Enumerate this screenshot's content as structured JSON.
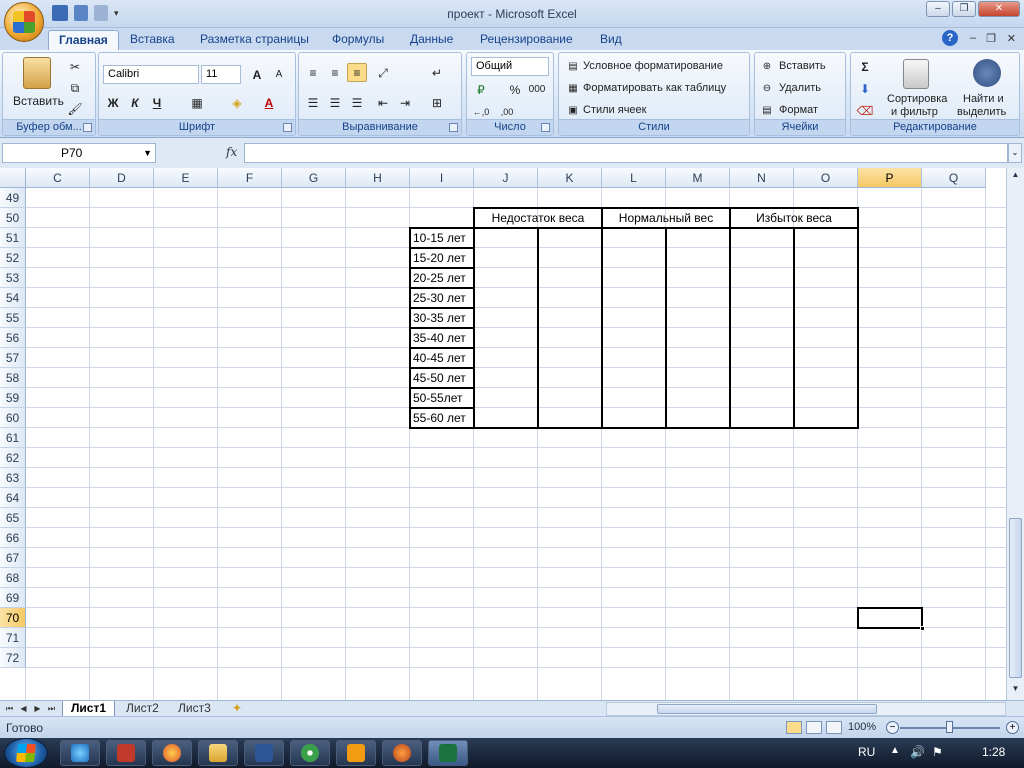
{
  "window": {
    "title": "проект - Microsoft Excel"
  },
  "ribbon_tabs": [
    "Главная",
    "Вставка",
    "Разметка страницы",
    "Формулы",
    "Данные",
    "Рецензирование",
    "Вид"
  ],
  "ribbon": {
    "clipboard": {
      "paste": "Вставить",
      "label": "Буфер обм..."
    },
    "font": {
      "name": "Calibri",
      "size": "11",
      "bold": "Ж",
      "italic": "К",
      "underline": "Ч",
      "label": "Шрифт"
    },
    "alignment": {
      "label": "Выравнивание"
    },
    "number": {
      "format": "Общий",
      "percent": "%",
      "thousands": "000",
      "label": "Число"
    },
    "styles": {
      "conditional": "Условное форматирование",
      "format_table": "Форматировать как таблицу",
      "cell_styles": "Стили ячеек",
      "label": "Стили"
    },
    "cells": {
      "insert": "Вставить",
      "delete": "Удалить",
      "format": "Формат",
      "label": "Ячейки"
    },
    "editing": {
      "sum": "Σ",
      "sort_line1": "Сортировка",
      "sort_line2": "и фильтр",
      "find_line1": "Найти и",
      "find_line2": "выделить",
      "label": "Редактирование"
    }
  },
  "formula_bar": {
    "name_box": "P70",
    "fx": "fx",
    "formula": ""
  },
  "columns": [
    "C",
    "D",
    "E",
    "F",
    "G",
    "H",
    "I",
    "J",
    "K",
    "L",
    "M",
    "N",
    "O",
    "P",
    "Q"
  ],
  "rows": [
    "49",
    "50",
    "51",
    "52",
    "53",
    "54",
    "55",
    "56",
    "57",
    "58",
    "59",
    "60",
    "61",
    "62",
    "63",
    "64",
    "65",
    "66",
    "67",
    "68",
    "69",
    "70",
    "71",
    "72"
  ],
  "selected": {
    "column": "P",
    "row": "70"
  },
  "table": {
    "headers": [
      "Недостаток веса",
      "Нормальный вес",
      "Избыток веса"
    ],
    "age_groups": [
      "10-15 лет",
      "15-20 лет",
      "20-25 лет",
      "25-30 лет",
      "30-35 лет",
      "35-40 лет",
      "40-45 лет",
      "45-50 лет",
      "50-55лет",
      "55-60 лет"
    ]
  },
  "sheet_tabs": [
    "Лист1",
    "Лист2",
    "Лист3"
  ],
  "active_sheet": "Лист1",
  "status": {
    "text": "Готово",
    "zoom": "100%"
  },
  "taskbar": {
    "language": "RU",
    "time": "1:28"
  }
}
